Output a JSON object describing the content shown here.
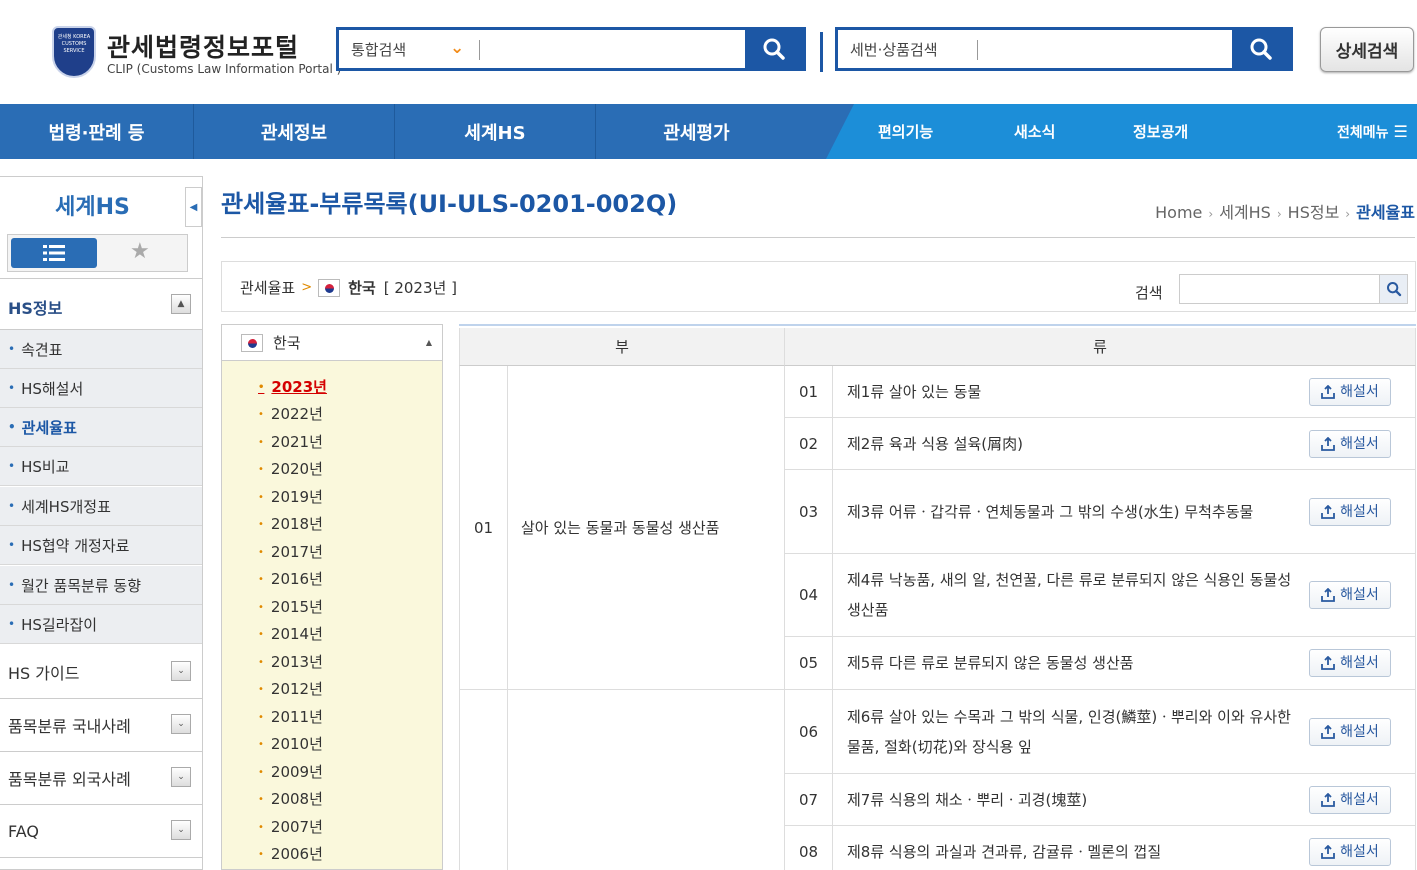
{
  "header": {
    "logo_emblem_text": "관세청 KOREA CUSTOMS SERVICE",
    "logo_title": "관세법령정보포털",
    "logo_subtitle": "CLIP (Customs Law Information Portal )",
    "search1": {
      "type_label": "통합검색",
      "value": "",
      "placeholder": ""
    },
    "search2": {
      "type_label": "세번·상품검색",
      "value": "",
      "placeholder": ""
    },
    "detail_search_label": "상세검색"
  },
  "nav": {
    "main": [
      "법령·판례 등",
      "관세정보",
      "세계HS",
      "관세평가"
    ],
    "sub": [
      "편의기능",
      "새소식",
      "정보공개"
    ],
    "all_menu": "전체메뉴"
  },
  "sidebar": {
    "title": "세계HS",
    "section": "HS정보",
    "items": [
      "속견표",
      "HS해설서",
      "관세율표",
      "HS비교",
      "세계HS개정표",
      "HS협약 개정자료",
      "월간 품목분류 동향",
      "HS길라잡이"
    ],
    "active_item": "관세율표",
    "groups": [
      "HS 가이드",
      "품목분류 국내사례",
      "품목분류 외국사례",
      "FAQ"
    ]
  },
  "main": {
    "title": "관세율표-부류목록(UI-ULS-0201-002Q)",
    "breadcrumb": [
      "Home",
      "세계HS",
      "HS정보",
      "관세율표"
    ],
    "path": {
      "root": "관세율표",
      "sep": ">",
      "country": "한국",
      "year": "[ 2023년 ]"
    },
    "search_label": "검색",
    "search_value": ""
  },
  "year_panel": {
    "country": "한국",
    "years": [
      "2023년",
      "2022년",
      "2021년",
      "2020년",
      "2019년",
      "2018년",
      "2017년",
      "2016년",
      "2015년",
      "2014년",
      "2013년",
      "2012년",
      "2011년",
      "2010년",
      "2009년",
      "2008년",
      "2007년",
      "2006년"
    ],
    "active_year": "2023년"
  },
  "table": {
    "headers": {
      "section": "부",
      "chapter": "류"
    },
    "sections": [
      {
        "no": "01",
        "title": "살아 있는 동물과 동물성 생산품"
      },
      {
        "no": "",
        "title": ""
      }
    ],
    "rows": [
      {
        "no": "01",
        "title": "제1류 살아 있는 동물",
        "button": "해설서"
      },
      {
        "no": "02",
        "title": "제2류 육과 식용 설육(屑肉)",
        "button": "해설서"
      },
      {
        "no": "03",
        "title": "제3류 어류ㆍ갑각류ㆍ연체동물과 그 밖의 수생(水生) 무척추동물",
        "button": "해설서"
      },
      {
        "no": "04",
        "title": "제4류 낙농품, 새의 알, 천연꿀, 다른 류로 분류되지 않은 식용인 동물성 생산품",
        "button": "해설서"
      },
      {
        "no": "05",
        "title": "제5류 다른 류로 분류되지 않은 동물성 생산품",
        "button": "해설서"
      },
      {
        "no": "06",
        "title": "제6류 살아 있는 수목과 그 밖의 식물, 인경(鱗莖)ㆍ뿌리와 이와 유사한 물품, 절화(切花)와 장식용 잎",
        "button": "해설서"
      },
      {
        "no": "07",
        "title": "제7류 식용의 채소ㆍ뿌리ㆍ괴경(塊莖)",
        "button": "해설서"
      },
      {
        "no": "08",
        "title": "제8류 식용의 과실과 견과류, 감귤류ㆍ멜론의 껍질",
        "button": "해설서"
      }
    ]
  }
}
